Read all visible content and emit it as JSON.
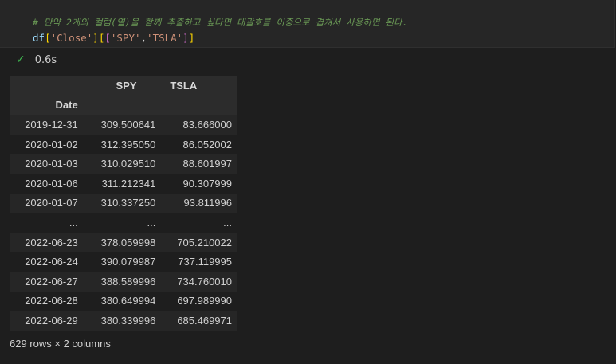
{
  "code_cell": {
    "comment": "# 만약 2개의 컬럼(열)을 함께 추출하고 싶다면 대괄호를 이중으로 겹쳐서 사용하면 된다.",
    "code_tokens": {
      "df": "df",
      "open1": "[",
      "close_key": "'Close'",
      "close1": "]",
      "open2": "[",
      "open3": "[",
      "spy_key": "'SPY'",
      "comma": ",",
      "tsla_key": "'TSLA'",
      "close3": "]",
      "close2": "]"
    }
  },
  "execution": {
    "duration": "0.6s",
    "status_icon": "check-icon",
    "status_color": "#3fb950"
  },
  "output_table": {
    "columns": [
      "SPY",
      "TSLA"
    ],
    "index_name": "Date",
    "rows": [
      [
        "2019-12-31",
        "309.500641",
        "83.666000"
      ],
      [
        "2020-01-02",
        "312.395050",
        "86.052002"
      ],
      [
        "2020-01-03",
        "310.029510",
        "88.601997"
      ],
      [
        "2020-01-06",
        "311.212341",
        "90.307999"
      ],
      [
        "2020-01-07",
        "310.337250",
        "93.811996"
      ],
      [
        "...",
        "...",
        "..."
      ],
      [
        "2022-06-23",
        "378.059998",
        "705.210022"
      ],
      [
        "2022-06-24",
        "390.079987",
        "737.119995"
      ],
      [
        "2022-06-27",
        "388.589996",
        "734.760010"
      ],
      [
        "2022-06-28",
        "380.649994",
        "697.989990"
      ],
      [
        "2022-06-29",
        "380.339996",
        "685.469971"
      ]
    ],
    "shape_text": "629 rows × 2 columns"
  }
}
